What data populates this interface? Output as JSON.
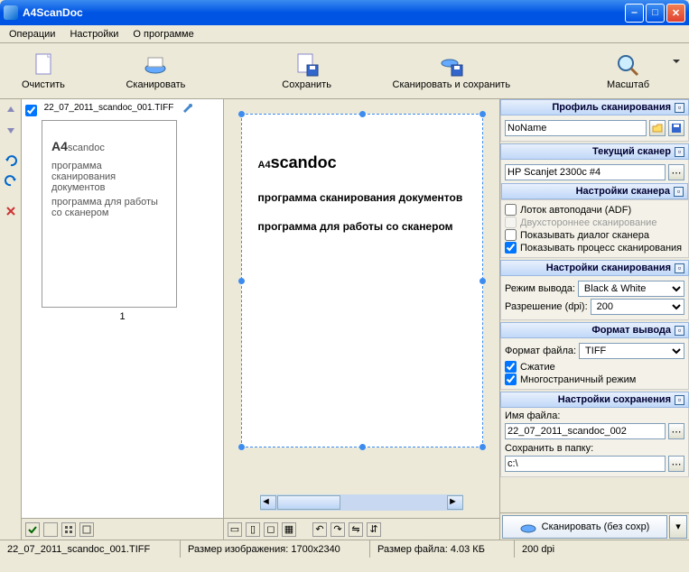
{
  "title": "A4ScanDoc",
  "menu": {
    "operations": "Операции",
    "settings": "Настройки",
    "about": "О программе"
  },
  "toolbar": {
    "clear": "Очистить",
    "scan": "Сканировать",
    "save": "Сохранить",
    "scansave": "Сканировать и сохранить",
    "zoom": "Масштаб"
  },
  "thumb": {
    "filename": "22_07_2011_scandoc_001.TIFF",
    "page": "1",
    "brand": "A4",
    "brandsm": "scandoc",
    "t2": "программа сканирования документов",
    "t3": "программа для работы со сканером"
  },
  "preview": {
    "brand": "A4",
    "brandsm": "scandoc",
    "l2": "программа сканирования  документов",
    "l3": "программа для работы со сканером"
  },
  "right": {
    "profile_hdr": "Профиль сканирования",
    "profile_name": "NoName",
    "scanner_hdr": "Текущий сканер",
    "scanner_name": "HP Scanjet 2300c #4",
    "scanner_opts_hdr": "Настройки сканера",
    "opt_adf": "Лоток автоподачи (ADF)",
    "opt_duplex": "Двухстороннее сканирование",
    "opt_dialog": "Показывать диалог сканера",
    "opt_progress": "Показывать процесс сканирования",
    "scanset_hdr": "Настройки сканирования",
    "mode_lbl": "Режим вывода:",
    "mode_val": "Black & White",
    "dpi_lbl": "Разрешение (dpi):",
    "dpi_val": "200",
    "fmt_hdr": "Формат вывода",
    "fmt_lbl": "Формат файла:",
    "fmt_val": "TIFF",
    "compress": "Сжатие",
    "multipage": "Многостраничный режим",
    "save_hdr": "Настройки сохранения",
    "fname_lbl": "Имя файла:",
    "fname_val": "22_07_2011_scandoc_002",
    "folder_lbl": "Сохранить в папку:",
    "folder_val": "c:\\",
    "scan_nosave": "Сканировать (без сохр)"
  },
  "status": {
    "file": "22_07_2011_scandoc_001.TIFF",
    "imgsize_lbl": "Размер изображения:",
    "imgsize": "1700x2340",
    "filesize_lbl": "Размер файла:",
    "filesize": "4.03 КБ",
    "dpi": "200 dpi"
  }
}
